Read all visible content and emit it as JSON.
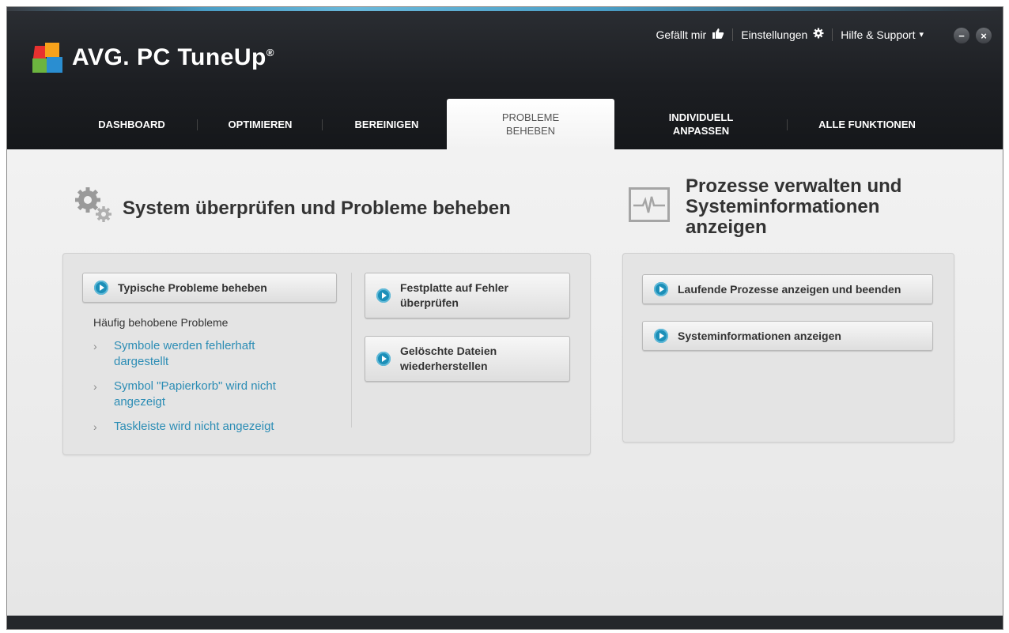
{
  "app": {
    "name": "AVG. PC TuneUp",
    "registered": "®"
  },
  "toplinks": {
    "like": "Gefällt mir",
    "like_icon": "thumbs-up-icon",
    "settings": "Einstellungen",
    "settings_icon": "gear-icon",
    "help": "Hilfe & Support",
    "help_icon": "caret-down-icon",
    "help_caret": "▾"
  },
  "window_buttons": {
    "minimize": "−",
    "close": "×"
  },
  "tabs": [
    {
      "label": "DASHBOARD",
      "active": false
    },
    {
      "label": "OPTIMIEREN",
      "active": false
    },
    {
      "label": "BEREINIGEN",
      "active": false
    },
    {
      "label": "PROBLEME\nBEHEBEN",
      "active": true
    },
    {
      "label": "INDIVIDUELL\nANPASSEN",
      "active": false
    },
    {
      "label": "ALLE FUNKTIONEN",
      "active": false
    }
  ],
  "left_section": {
    "title": "System überprüfen und Probleme beheben",
    "icon": "gears-icon",
    "main_button": "Typische Probleme beheben",
    "subheading": "Häufig behobene Probleme",
    "issues": [
      "Symbole werden fehlerhaft\ndargestellt",
      "Symbol \"Papierkorb\" wird nicht\nangezeigt",
      "Taskleiste wird nicht angezeigt"
    ],
    "buttons": [
      "Festplatte auf Fehler\nüberprüfen",
      "Gelöschte Dateien\nwiederherstellen"
    ]
  },
  "right_section": {
    "title": "Prozesse verwalten und\nSysteminformationen\nanzeigen",
    "icon": "activity-monitor-icon",
    "buttons": [
      "Laufende Prozesse anzeigen und beenden",
      "Systeminformationen anzeigen"
    ]
  },
  "colors": {
    "accent": "#1c8fb8",
    "link": "#2c8db5",
    "header_bg": "#1c1e22"
  }
}
